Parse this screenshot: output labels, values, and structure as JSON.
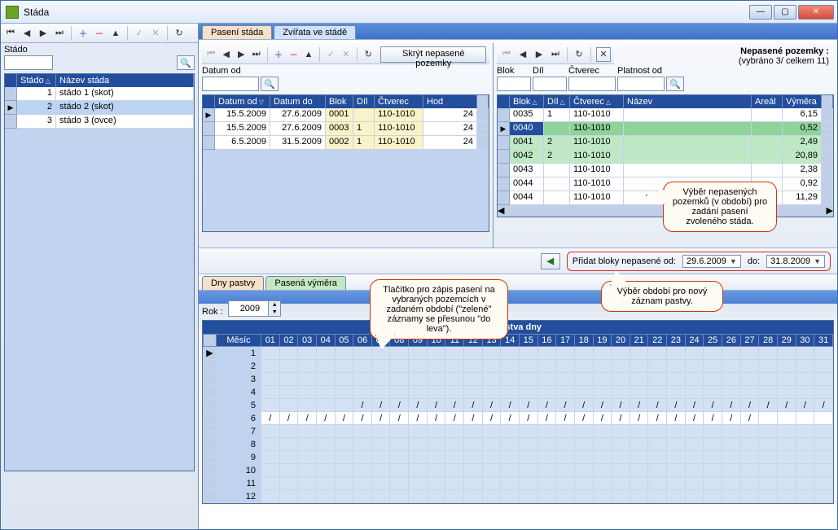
{
  "window": {
    "title": "Stáda"
  },
  "tabs": {
    "paseni": "Pasení stáda",
    "zvirata": "Zvířata ve stádě",
    "dnyPastvy": "Dny pastvy",
    "pasenaVymera": "Pasená výměra"
  },
  "left": {
    "label": "Stádo",
    "headers": {
      "stado": "Stádo",
      "nazev": "Název stáda"
    },
    "rows": [
      {
        "id": "1",
        "name": "stádo 1 (skot)"
      },
      {
        "id": "2",
        "name": "stádo 2 (skot)"
      },
      {
        "id": "3",
        "name": "stádo 3 (ovce)"
      }
    ],
    "selectedIndex": 1
  },
  "midPanel": {
    "toolbarBtn": "Skrýt nepasené pozemky",
    "filterLabel": "Datum od",
    "headers": {
      "datumOd": "Datum od",
      "datumDo": "Datum do",
      "blok": "Blok",
      "dil": "Díl",
      "ctverec": "Čtverec",
      "hod": "Hod"
    },
    "rows": [
      {
        "od": "15.5.2009",
        "do": "27.6.2009",
        "blok": "0001",
        "dil": "",
        "ctverec": "110-1010",
        "hod": "24"
      },
      {
        "od": "15.5.2009",
        "do": "27.6.2009",
        "blok": "0003",
        "dil": "1",
        "ctverec": "110-1010",
        "hod": "24"
      },
      {
        "od": "6.5.2009",
        "do": "31.5.2009",
        "blok": "0002",
        "dil": "1",
        "ctverec": "110-1010",
        "hod": "24"
      }
    ]
  },
  "rightPanel": {
    "title": "Nepasené pozemky :",
    "subtitle": "(vybráno 3/ celkem 11)",
    "filters": {
      "blok": "Blok",
      "dil": "Díl",
      "ctverec": "Čtverec",
      "platnost": "Platnost od"
    },
    "headers": {
      "blok": "Blok",
      "dil": "Díl",
      "ctverec": "Čtverec",
      "nazev": "Název",
      "areal": "Areál",
      "vymera": "Výměra"
    },
    "rows": [
      {
        "blok": "0035",
        "dil": "1",
        "ctverec": "110-1010",
        "nazev": "",
        "areal": "",
        "vymera": "6,15",
        "sel": false
      },
      {
        "blok": "0040",
        "dil": "",
        "ctverec": "110-1010",
        "nazev": "",
        "areal": "",
        "vymera": "0,52",
        "sel": true
      },
      {
        "blok": "0041",
        "dil": "2",
        "ctverec": "110-1010",
        "nazev": "",
        "areal": "",
        "vymera": "2,49",
        "sel": true
      },
      {
        "blok": "0042",
        "dil": "2",
        "ctverec": "110-1010",
        "nazev": "",
        "areal": "",
        "vymera": "20,89",
        "sel": true
      },
      {
        "blok": "0043",
        "dil": "",
        "ctverec": "110-1010",
        "nazev": "",
        "areal": "",
        "vymera": "2,38",
        "sel": false
      },
      {
        "blok": "0044",
        "dil": "",
        "ctverec": "110-1010",
        "nazev": "",
        "areal": "",
        "vymera": "0,92",
        "sel": false
      },
      {
        "blok": "0044",
        "dil": "",
        "ctverec": "110-1010",
        "nazev": "",
        "areal": "",
        "vymera": "11,29",
        "sel": false
      }
    ]
  },
  "addBar": {
    "label": "Přidat bloky nepasené od:",
    "from": "29.6.2009",
    "toLabel": "do:",
    "to": "31.8.2009"
  },
  "callouts": {
    "vyber": "Výběr nepasených\npozemků (v období)\npro zadání pasení\nzvoleného stáda.",
    "tlacitko": "Tlačítko pro zápis pasení\nna vybraných pozemcích\nv zadaném období\n(\"zelené\" záznamy se\npřesunou \"do leva\").",
    "obdobi": "Výběr období pro nový\nzáznam pastvy."
  },
  "bottom": {
    "rokLabel": "Rok :",
    "rok": "2009",
    "title": "Pastva dny",
    "mesic": "Měsíc",
    "months": [
      "1",
      "2",
      "3",
      "4",
      "5",
      "6",
      "7",
      "8",
      "9",
      "10",
      "11",
      "12"
    ],
    "days": [
      "01",
      "02",
      "03",
      "04",
      "05",
      "06",
      "07",
      "08",
      "09",
      "10",
      "11",
      "12",
      "13",
      "14",
      "15",
      "16",
      "17",
      "18",
      "19",
      "20",
      "21",
      "22",
      "23",
      "24",
      "25",
      "26",
      "27",
      "28",
      "29",
      "30",
      "31"
    ],
    "marks": {
      "5": [
        6,
        7,
        8,
        9,
        10,
        11,
        12,
        13,
        14,
        15,
        16,
        17,
        18,
        19,
        20,
        21,
        22,
        23,
        24,
        25,
        26,
        27,
        28,
        29,
        30,
        31
      ],
      "6": [
        1,
        2,
        3,
        4,
        5,
        6,
        7,
        8,
        9,
        10,
        11,
        12,
        13,
        14,
        15,
        16,
        17,
        18,
        19,
        20,
        21,
        22,
        23,
        24,
        25,
        26,
        27
      ]
    }
  }
}
